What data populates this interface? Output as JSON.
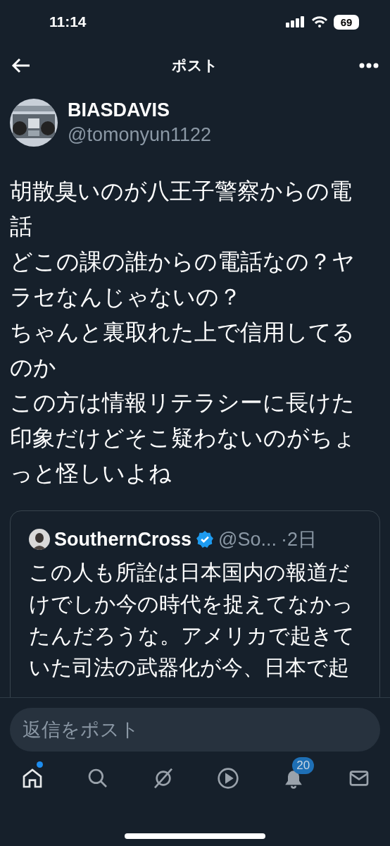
{
  "status_bar": {
    "time": "11:14",
    "battery": "69"
  },
  "header": {
    "title": "ポスト"
  },
  "post": {
    "author": {
      "name": "BIASDAVIS",
      "handle": "@tomonyun1122"
    },
    "paragraphs": [
      "胡散臭いのが八王子警察からの電話",
      "どこの課の誰からの電話なの？ヤラセなんじゃないの？",
      "ちゃんと裏取れた上で信用してるのか",
      "この方は情報リテラシーに長けた印象だけどそこ疑わないのがちょっと怪しいよね"
    ],
    "quote": {
      "name": "SouthernCross",
      "verified": true,
      "handle": "@So...",
      "time": "·2日",
      "text": "この人も所詮は日本国内の報道だけでしか今の時代を捉えてなかったんだろうな。アメリカで起きていた司法の武器化が今、日本で起"
    }
  },
  "reply": {
    "placeholder": "返信をポスト"
  },
  "tabs": [
    {
      "kind": "home",
      "selected": true,
      "dot": true
    },
    {
      "kind": "search",
      "selected": false
    },
    {
      "kind": "grok",
      "selected": false
    },
    {
      "kind": "video",
      "selected": false
    },
    {
      "kind": "bell",
      "selected": false,
      "badge": "20"
    },
    {
      "kind": "mail",
      "selected": false
    }
  ]
}
